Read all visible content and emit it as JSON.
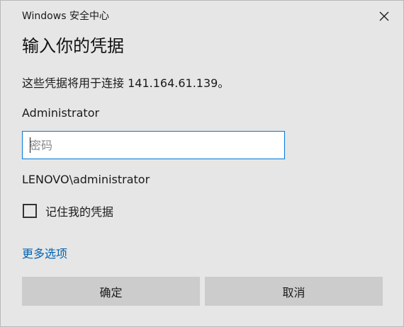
{
  "window": {
    "title": "Windows 安全中心"
  },
  "dialog": {
    "heading": "输入你的凭据",
    "subtitle": "这些凭据将用于连接 141.164.61.139。",
    "username": "Administrator",
    "password": {
      "value": "",
      "placeholder": "密码"
    },
    "domain_user": "LENOVO\\administrator",
    "remember": {
      "label": "记住我的凭据",
      "checked": false
    },
    "more_options": "更多选项",
    "buttons": {
      "ok": "确定",
      "cancel": "取消"
    }
  },
  "icons": {
    "close": "close-icon"
  },
  "colors": {
    "background": "#e6e6e6",
    "accent": "#0078d7",
    "link": "#0063b1",
    "button": "#cccccc"
  }
}
